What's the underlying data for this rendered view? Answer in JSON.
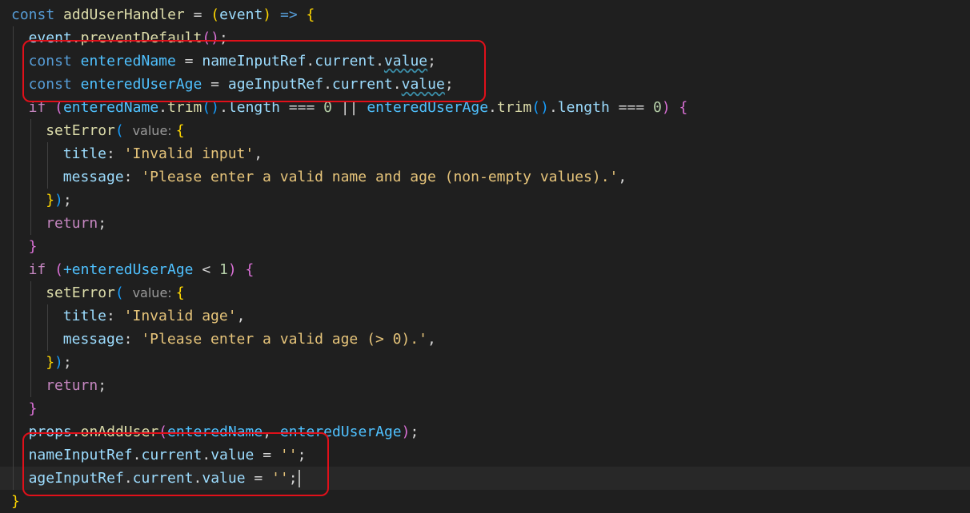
{
  "lines": [
    {
      "indent": 0,
      "tokens": [
        {
          "t": "const ",
          "c": "t-kw"
        },
        {
          "t": "addUserHandler",
          "c": "t-fn"
        },
        {
          "t": " = ",
          "c": "t-op"
        },
        {
          "t": "(",
          "c": "t-br1"
        },
        {
          "t": "event",
          "c": "t-var"
        },
        {
          "t": ")",
          "c": "t-br1"
        },
        {
          "t": " => ",
          "c": "t-kw"
        },
        {
          "t": "{",
          "c": "t-br1"
        }
      ]
    },
    {
      "indent": 1,
      "tokens": [
        {
          "t": "event",
          "c": "t-var"
        },
        {
          "t": ".",
          "c": "t-op"
        },
        {
          "t": "preventDefault",
          "c": "t-fn"
        },
        {
          "t": "()",
          "c": "t-br2"
        },
        {
          "t": ";",
          "c": "t-op"
        }
      ]
    },
    {
      "indent": 1,
      "tokens": [
        {
          "t": "const ",
          "c": "t-kw"
        },
        {
          "t": "enteredName",
          "c": "t-prop"
        },
        {
          "t": " = ",
          "c": "t-op"
        },
        {
          "t": "nameInputRef",
          "c": "t-var"
        },
        {
          "t": ".",
          "c": "t-op"
        },
        {
          "t": "current",
          "c": "t-var"
        },
        {
          "t": ".",
          "c": "t-op"
        },
        {
          "t": "value",
          "c": "t-var t-squig"
        },
        {
          "t": ";",
          "c": "t-op"
        }
      ]
    },
    {
      "indent": 1,
      "tokens": [
        {
          "t": "const ",
          "c": "t-kw"
        },
        {
          "t": "enteredUserAge",
          "c": "t-prop"
        },
        {
          "t": " = ",
          "c": "t-op"
        },
        {
          "t": "ageInputRef",
          "c": "t-var"
        },
        {
          "t": ".",
          "c": "t-op"
        },
        {
          "t": "current",
          "c": "t-var"
        },
        {
          "t": ".",
          "c": "t-op"
        },
        {
          "t": "value",
          "c": "t-var t-squig"
        },
        {
          "t": ";",
          "c": "t-op"
        }
      ]
    },
    {
      "indent": 1,
      "tokens": [
        {
          "t": "if ",
          "c": "t-ctrl"
        },
        {
          "t": "(",
          "c": "t-br2"
        },
        {
          "t": "enteredName",
          "c": "t-prop"
        },
        {
          "t": ".",
          "c": "t-op"
        },
        {
          "t": "trim",
          "c": "t-fn"
        },
        {
          "t": "()",
          "c": "t-br3"
        },
        {
          "t": ".",
          "c": "t-op"
        },
        {
          "t": "length",
          "c": "t-var"
        },
        {
          "t": " === ",
          "c": "t-op"
        },
        {
          "t": "0",
          "c": "t-num"
        },
        {
          "t": " || ",
          "c": "t-op"
        },
        {
          "t": "enteredUserAge",
          "c": "t-prop"
        },
        {
          "t": ".",
          "c": "t-op"
        },
        {
          "t": "trim",
          "c": "t-fn"
        },
        {
          "t": "()",
          "c": "t-br3"
        },
        {
          "t": ".",
          "c": "t-op"
        },
        {
          "t": "length",
          "c": "t-var"
        },
        {
          "t": " === ",
          "c": "t-op"
        },
        {
          "t": "0",
          "c": "t-num"
        },
        {
          "t": ")",
          "c": "t-br2"
        },
        {
          "t": " {",
          "c": "t-br2"
        }
      ]
    },
    {
      "indent": 2,
      "tokens": [
        {
          "t": "setError",
          "c": "t-fn"
        },
        {
          "t": "( ",
          "c": "t-br3"
        },
        {
          "t": "value: ",
          "c": "t-hint"
        },
        {
          "t": "{",
          "c": "t-br1"
        }
      ]
    },
    {
      "indent": 3,
      "tokens": [
        {
          "t": "title",
          "c": "t-var"
        },
        {
          "t": ": ",
          "c": "t-op"
        },
        {
          "t": "'Invalid input'",
          "c": "t-str2"
        },
        {
          "t": ",",
          "c": "t-op"
        }
      ]
    },
    {
      "indent": 3,
      "tokens": [
        {
          "t": "message",
          "c": "t-var"
        },
        {
          "t": ": ",
          "c": "t-op"
        },
        {
          "t": "'Please enter a valid name and age (non-empty values).'",
          "c": "t-str2"
        },
        {
          "t": ",",
          "c": "t-op"
        }
      ]
    },
    {
      "indent": 2,
      "tokens": [
        {
          "t": "}",
          "c": "t-br1"
        },
        {
          "t": ")",
          "c": "t-br3"
        },
        {
          "t": ";",
          "c": "t-op"
        }
      ]
    },
    {
      "indent": 2,
      "tokens": [
        {
          "t": "return",
          "c": "t-ctrl"
        },
        {
          "t": ";",
          "c": "t-op"
        }
      ]
    },
    {
      "indent": 1,
      "tokens": [
        {
          "t": "}",
          "c": "t-br2"
        }
      ]
    },
    {
      "indent": 1,
      "tokens": [
        {
          "t": "if ",
          "c": "t-ctrl"
        },
        {
          "t": "(",
          "c": "t-br2"
        },
        {
          "t": "+enteredUserAge",
          "c": "t-prop"
        },
        {
          "t": " < ",
          "c": "t-op"
        },
        {
          "t": "1",
          "c": "t-num"
        },
        {
          "t": ")",
          "c": "t-br2"
        },
        {
          "t": " {",
          "c": "t-br2"
        }
      ]
    },
    {
      "indent": 2,
      "tokens": [
        {
          "t": "setError",
          "c": "t-fn"
        },
        {
          "t": "( ",
          "c": "t-br3"
        },
        {
          "t": "value: ",
          "c": "t-hint"
        },
        {
          "t": "{",
          "c": "t-br1"
        }
      ]
    },
    {
      "indent": 3,
      "tokens": [
        {
          "t": "title",
          "c": "t-var"
        },
        {
          "t": ": ",
          "c": "t-op"
        },
        {
          "t": "'Invalid age'",
          "c": "t-str2"
        },
        {
          "t": ",",
          "c": "t-op"
        }
      ]
    },
    {
      "indent": 3,
      "tokens": [
        {
          "t": "message",
          "c": "t-var"
        },
        {
          "t": ": ",
          "c": "t-op"
        },
        {
          "t": "'Please enter a valid age (> 0).'",
          "c": "t-str2"
        },
        {
          "t": ",",
          "c": "t-op"
        }
      ]
    },
    {
      "indent": 2,
      "tokens": [
        {
          "t": "}",
          "c": "t-br1"
        },
        {
          "t": ")",
          "c": "t-br3"
        },
        {
          "t": ";",
          "c": "t-op"
        }
      ]
    },
    {
      "indent": 2,
      "tokens": [
        {
          "t": "return",
          "c": "t-ctrl"
        },
        {
          "t": ";",
          "c": "t-op"
        }
      ]
    },
    {
      "indent": 1,
      "tokens": [
        {
          "t": "}",
          "c": "t-br2"
        }
      ]
    },
    {
      "indent": 1,
      "tokens": [
        {
          "t": "props",
          "c": "t-var"
        },
        {
          "t": ".",
          "c": "t-op"
        },
        {
          "t": "onAddUser",
          "c": "t-fn"
        },
        {
          "t": "(",
          "c": "t-br2"
        },
        {
          "t": "enteredName",
          "c": "t-prop"
        },
        {
          "t": ", ",
          "c": "t-op"
        },
        {
          "t": "enteredUserAge",
          "c": "t-prop"
        },
        {
          "t": ")",
          "c": "t-br2"
        },
        {
          "t": ";",
          "c": "t-op"
        }
      ]
    },
    {
      "indent": 1,
      "tokens": [
        {
          "t": "nameInputRef",
          "c": "t-var"
        },
        {
          "t": ".",
          "c": "t-op"
        },
        {
          "t": "current",
          "c": "t-var"
        },
        {
          "t": ".",
          "c": "t-op"
        },
        {
          "t": "value",
          "c": "t-var"
        },
        {
          "t": " = ",
          "c": "t-op"
        },
        {
          "t": "''",
          "c": "t-str2"
        },
        {
          "t": ";",
          "c": "t-op"
        }
      ]
    },
    {
      "indent": 1,
      "current": true,
      "cursor": true,
      "tokens": [
        {
          "t": "ageInputRef",
          "c": "t-var"
        },
        {
          "t": ".",
          "c": "t-op"
        },
        {
          "t": "current",
          "c": "t-var"
        },
        {
          "t": ".",
          "c": "t-op"
        },
        {
          "t": "value",
          "c": "t-var"
        },
        {
          "t": " = ",
          "c": "t-op"
        },
        {
          "t": "''",
          "c": "t-str2"
        },
        {
          "t": ";",
          "c": "t-op"
        }
      ]
    },
    {
      "indent": 0,
      "tokens": [
        {
          "t": "}",
          "c": "t-br1"
        }
      ]
    }
  ],
  "annotations": [
    {
      "label": "const-declarations",
      "from_line": 2,
      "to_line": 3
    },
    {
      "label": "ref-reset-statements",
      "from_line": 19,
      "to_line": 20
    }
  ],
  "colors": {
    "background": "#1f1f1f",
    "current_line": "#282828",
    "annotation": "#e0101a"
  }
}
